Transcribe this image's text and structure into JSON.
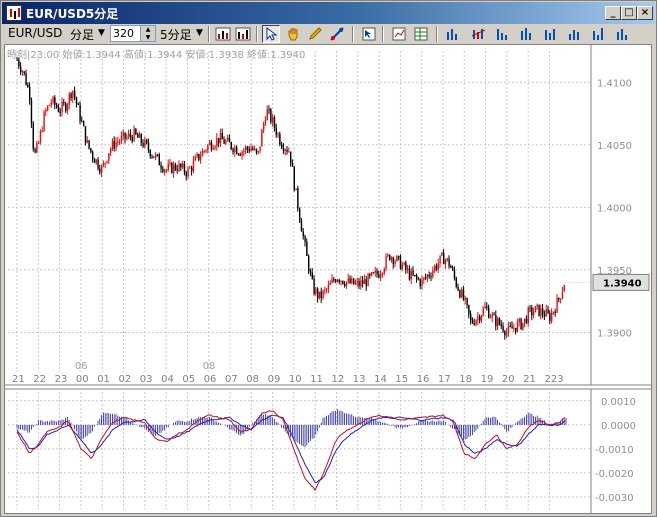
{
  "window": {
    "title": "EUR/USD5分足"
  },
  "toolbar": {
    "symbol": "EUR/USD",
    "period_type": "分足",
    "bar_count": "320",
    "timeframe": "5分足"
  },
  "info_bar": "時刻|23:00 始値:1.3944 高値:1.3944 安値:1.3938 終値:1.3940",
  "price_axis": {
    "labels": [
      "1.4100",
      "1.4050",
      "1.4000",
      "1.3950",
      "1.3900"
    ],
    "current": "1.3940"
  },
  "date_labels": [
    "06",
    "08"
  ],
  "time_labels": [
    "21",
    "22",
    "23",
    "00",
    "01",
    "02",
    "03",
    "04",
    "05",
    "06",
    "07",
    "08",
    "09",
    "10",
    "11",
    "12",
    "13",
    "14",
    "15",
    "16",
    "17",
    "18",
    "19",
    "20",
    "21",
    "223"
  ],
  "macd_axis": {
    "labels": [
      "0.0010",
      "0.0000",
      "-0.0010",
      "-0.0020",
      "-0.0030"
    ]
  },
  "colors": {
    "up": "#e01010",
    "down": "#000000",
    "macd": "#c01020",
    "signal": "#2020c0",
    "hist": "#2020a0",
    "grid": "#c8c8c8",
    "current_bg": "#e0e0e0"
  },
  "chart_data": {
    "type": "candlestick",
    "symbol": "EUR/USD",
    "timeframe": "5分足",
    "ylim": [
      1.387,
      1.4125
    ],
    "x_ticks": [
      "21",
      "22",
      "23",
      "00",
      "01",
      "02",
      "03",
      "04",
      "05",
      "06",
      "07",
      "08",
      "09",
      "10",
      "11",
      "12",
      "13",
      "14",
      "15",
      "16",
      "17",
      "18",
      "19",
      "20",
      "21",
      "223"
    ],
    "close_path": [
      [
        21,
        1.4118
      ],
      [
        21.3,
        1.4108
      ],
      [
        21.6,
        1.409
      ],
      [
        21.8,
        1.404
      ],
      [
        22,
        1.405
      ],
      [
        22.3,
        1.4075
      ],
      [
        22.6,
        1.4085
      ],
      [
        23,
        1.4078
      ],
      [
        23.3,
        1.4082
      ],
      [
        23.6,
        1.4095
      ],
      [
        0,
        1.407
      ],
      [
        0.3,
        1.405
      ],
      [
        0.6,
        1.404
      ],
      [
        1,
        1.403
      ],
      [
        1.3,
        1.4045
      ],
      [
        1.6,
        1.4052
      ],
      [
        2,
        1.4055
      ],
      [
        2.5,
        1.4058
      ],
      [
        3,
        1.405
      ],
      [
        3.5,
        1.404
      ],
      [
        4,
        1.403
      ],
      [
        4.5,
        1.4033
      ],
      [
        5,
        1.4028
      ],
      [
        5.5,
        1.404
      ],
      [
        6,
        1.405
      ],
      [
        6.5,
        1.4055
      ],
      [
        7,
        1.405
      ],
      [
        7.5,
        1.4045
      ],
      [
        8,
        1.4048
      ],
      [
        8.3,
        1.404
      ],
      [
        8.5,
        1.406
      ],
      [
        8.7,
        1.4078
      ],
      [
        9,
        1.4068
      ],
      [
        9.4,
        1.4052
      ],
      [
        9.8,
        1.4045
      ],
      [
        10,
        1.402
      ],
      [
        10.3,
        1.399
      ],
      [
        10.6,
        1.396
      ],
      [
        10.9,
        1.3935
      ],
      [
        11.2,
        1.3928
      ],
      [
        11.6,
        1.3935
      ],
      [
        12,
        1.3945
      ],
      [
        12.5,
        1.394
      ],
      [
        13,
        1.3938
      ],
      [
        13.5,
        1.3942
      ],
      [
        14,
        1.3948
      ],
      [
        14.5,
        1.3962
      ],
      [
        15,
        1.3955
      ],
      [
        15.5,
        1.3945
      ],
      [
        16,
        1.394
      ],
      [
        16.5,
        1.395
      ],
      [
        17,
        1.396
      ],
      [
        17.3,
        1.3955
      ],
      [
        17.6,
        1.394
      ],
      [
        18,
        1.3925
      ],
      [
        18.3,
        1.3908
      ],
      [
        18.6,
        1.3912
      ],
      [
        19,
        1.392
      ],
      [
        19.4,
        1.391
      ],
      [
        19.8,
        1.3905
      ],
      [
        20,
        1.39
      ],
      [
        20.4,
        1.3905
      ],
      [
        20.8,
        1.3908
      ],
      [
        21,
        1.3915
      ],
      [
        21.4,
        1.3918
      ],
      [
        21.8,
        1.3915
      ],
      [
        22,
        1.3912
      ],
      [
        22.4,
        1.3925
      ],
      [
        22.7,
        1.394
      ]
    ],
    "current": 1.394,
    "indicator": {
      "type": "macd",
      "ylim": [
        -0.0035,
        0.0012
      ],
      "macd": [
        [
          21,
          -0.0003
        ],
        [
          21.6,
          -0.0012
        ],
        [
          22,
          -0.0008
        ],
        [
          22.4,
          -0.0003
        ],
        [
          23,
          -0.0001
        ],
        [
          23.4,
          0.0002
        ],
        [
          0,
          -0.001
        ],
        [
          0.5,
          -0.0014
        ],
        [
          1,
          -0.0005
        ],
        [
          1.5,
          0.0001
        ],
        [
          2,
          0.0003
        ],
        [
          3,
          0.0001
        ],
        [
          3.5,
          -0.0006
        ],
        [
          4,
          -0.0007
        ],
        [
          4.5,
          -0.0004
        ],
        [
          5,
          -0.0002
        ],
        [
          5.5,
          0.0002
        ],
        [
          6,
          0.0004
        ],
        [
          7,
          0.0002
        ],
        [
          7.5,
          -0.0003
        ],
        [
          8,
          -0.0002
        ],
        [
          8.5,
          0.0005
        ],
        [
          9,
          0.0006
        ],
        [
          9.5,
          0.0002
        ],
        [
          10,
          -0.001
        ],
        [
          10.5,
          -0.0022
        ],
        [
          11,
          -0.0027
        ],
        [
          11.4,
          -0.002
        ],
        [
          12,
          -0.0006
        ],
        [
          12.5,
          -0.0002
        ],
        [
          13,
          0.0
        ],
        [
          13.5,
          0.0003
        ],
        [
          14,
          0.0004
        ],
        [
          15,
          0.0002
        ],
        [
          16,
          0.0003
        ],
        [
          17,
          0.0004
        ],
        [
          17.5,
          0.0001
        ],
        [
          18,
          -0.0012
        ],
        [
          18.5,
          -0.0014
        ],
        [
          19,
          -0.0008
        ],
        [
          19.5,
          -0.0004
        ],
        [
          20,
          -0.001
        ],
        [
          20.5,
          -0.0008
        ],
        [
          21,
          -0.0001
        ],
        [
          21.5,
          0.0002
        ],
        [
          22,
          0.0
        ],
        [
          22.5,
          0.0001
        ],
        [
          22.8,
          0.0004
        ]
      ],
      "signal": [
        [
          21,
          -0.0002
        ],
        [
          21.6,
          -0.001
        ],
        [
          22,
          -0.0009
        ],
        [
          22.4,
          -0.0004
        ],
        [
          23,
          -0.0002
        ],
        [
          23.4,
          0.0
        ],
        [
          0,
          -0.0006
        ],
        [
          0.5,
          -0.0012
        ],
        [
          1,
          -0.0008
        ],
        [
          1.5,
          -0.0002
        ],
        [
          2,
          0.0001
        ],
        [
          3,
          0.0002
        ],
        [
          3.5,
          -0.0003
        ],
        [
          4,
          -0.0006
        ],
        [
          4.5,
          -0.0005
        ],
        [
          5,
          -0.0003
        ],
        [
          5.5,
          0.0
        ],
        [
          6,
          0.0002
        ],
        [
          7,
          0.0003
        ],
        [
          7.5,
          0.0
        ],
        [
          8,
          -0.0002
        ],
        [
          8.5,
          0.0002
        ],
        [
          9,
          0.0004
        ],
        [
          9.5,
          0.0003
        ],
        [
          10,
          -0.0006
        ],
        [
          10.5,
          -0.0016
        ],
        [
          11,
          -0.0024
        ],
        [
          11.4,
          -0.0022
        ],
        [
          12,
          -0.001
        ],
        [
          12.5,
          -0.0005
        ],
        [
          13,
          -0.0002
        ],
        [
          13.5,
          0.0001
        ],
        [
          14,
          0.0003
        ],
        [
          15,
          0.0003
        ],
        [
          16,
          0.0002
        ],
        [
          17,
          0.0003
        ],
        [
          17.5,
          0.0002
        ],
        [
          18,
          -0.0008
        ],
        [
          18.5,
          -0.0012
        ],
        [
          19,
          -0.001
        ],
        [
          19.5,
          -0.0006
        ],
        [
          20,
          -0.0008
        ],
        [
          20.5,
          -0.0009
        ],
        [
          21,
          -0.0004
        ],
        [
          21.5,
          0.0
        ],
        [
          22,
          0.0
        ],
        [
          22.5,
          0.0
        ],
        [
          22.8,
          0.0002
        ]
      ]
    }
  }
}
